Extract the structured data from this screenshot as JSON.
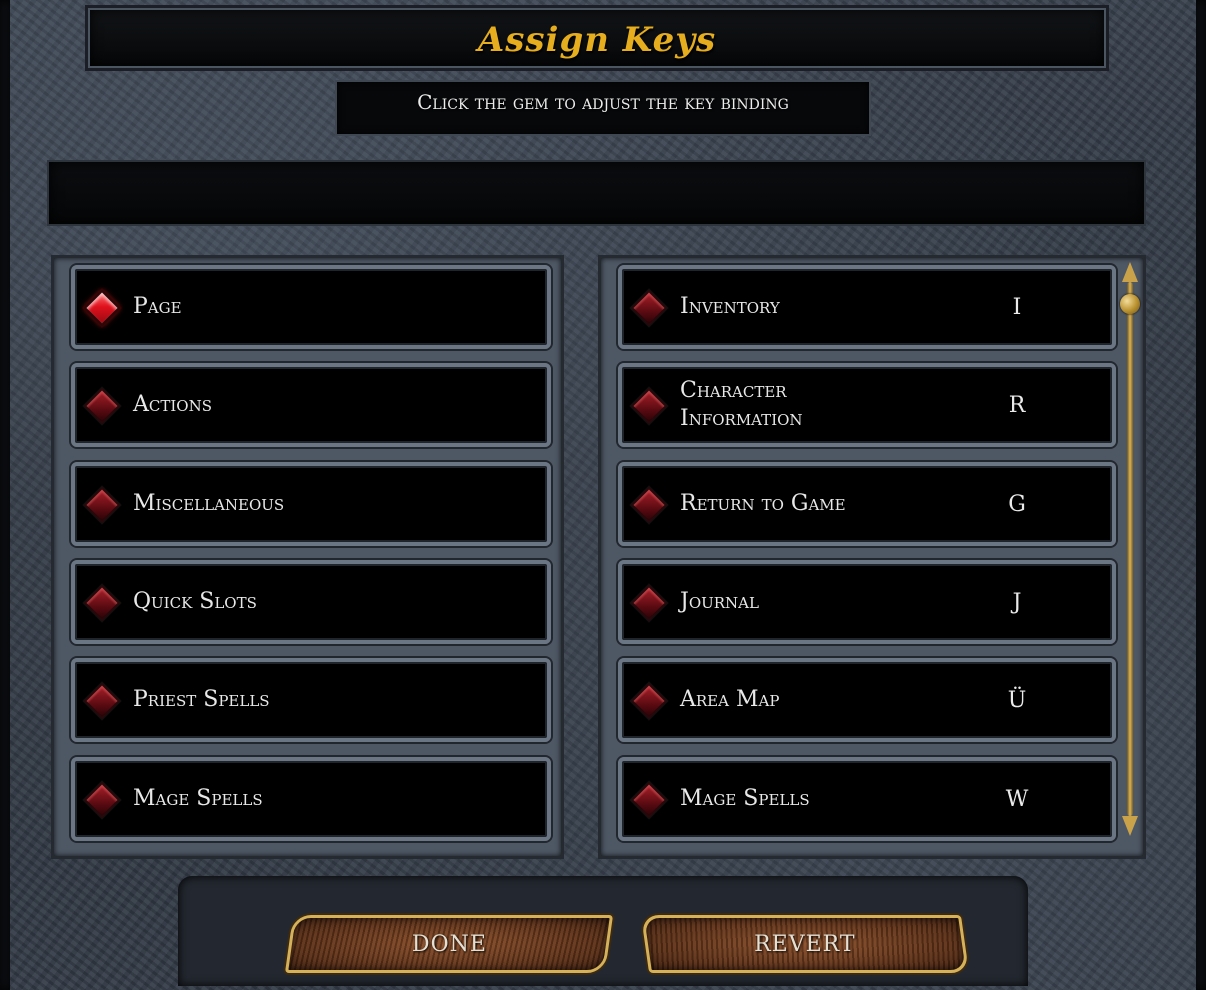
{
  "window": {
    "title": "Assign Keys",
    "subtitle": "Click the gem to adjust the key binding",
    "description": ""
  },
  "categories": [
    {
      "label": "Page",
      "active": true
    },
    {
      "label": "Actions",
      "active": false
    },
    {
      "label": "Miscellaneous",
      "active": false
    },
    {
      "label": "Quick Slots",
      "active": false
    },
    {
      "label": "Priest Spells",
      "active": false
    },
    {
      "label": "Mage Spells",
      "active": false
    }
  ],
  "bindings": [
    {
      "label": "Inventory",
      "key": "I"
    },
    {
      "label": "Character Information",
      "key": "R"
    },
    {
      "label": "Return to Game",
      "key": "G"
    },
    {
      "label": "Journal",
      "key": "J"
    },
    {
      "label": "Area Map",
      "key": "Ü"
    },
    {
      "label": "Mage Spells",
      "key": "W"
    }
  ],
  "buttons": {
    "done": "DONE",
    "revert": "REVERT"
  },
  "colors": {
    "title": "#e6ad1e",
    "gem": "#c0101a",
    "button_border": "#d5b259"
  }
}
